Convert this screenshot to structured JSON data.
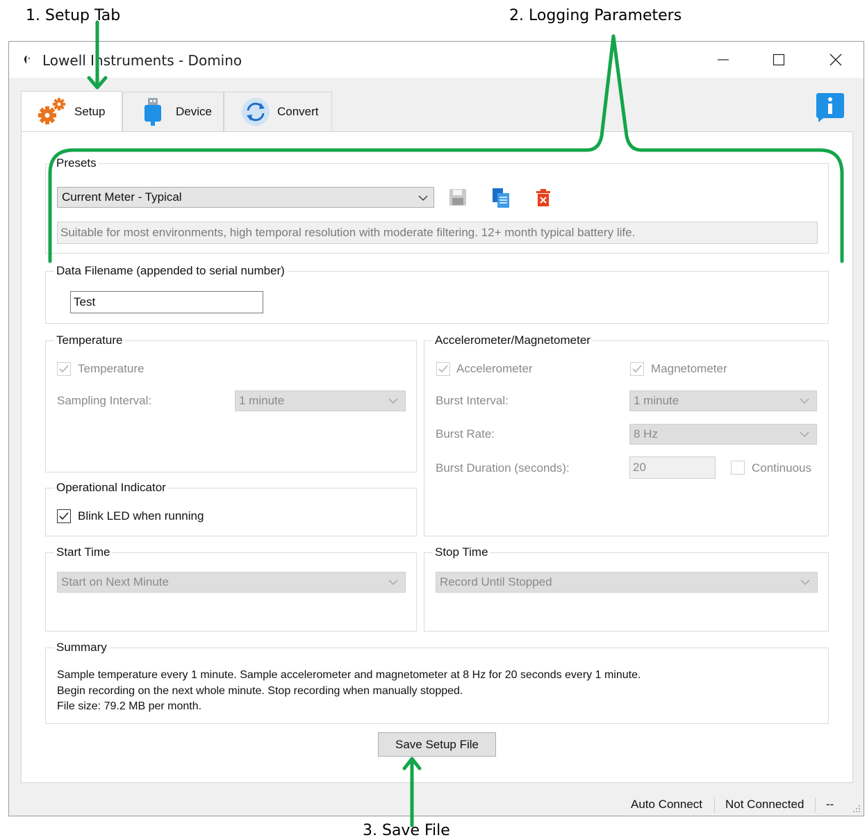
{
  "annotations": {
    "setup_tab": "1. Setup Tab",
    "logging_params": "2. Logging Parameters",
    "save_file": "3. Save File"
  },
  "colors": {
    "annotation_green": "#14a54a",
    "info_blue": "#1e90e6",
    "gear_orange": "#e8731c",
    "delete_red": "#e8401c"
  },
  "window": {
    "title": "Lowell Instruments - Domino",
    "minimize_icon": "minimize-icon",
    "maximize_icon": "maximize-icon",
    "close_icon": "close-icon"
  },
  "tabs": [
    {
      "label": "Setup",
      "icon": "gears-icon",
      "active": true
    },
    {
      "label": "Device",
      "icon": "usb-device-icon",
      "active": false
    },
    {
      "label": "Convert",
      "icon": "convert-refresh-icon",
      "active": false
    }
  ],
  "presets": {
    "group_label": "Presets",
    "selected": "Current Meter - Typical",
    "description": "Suitable for most environments, high temporal resolution with moderate filtering. 12+ month typical battery life."
  },
  "filename": {
    "group_label": "Data Filename (appended to serial number)",
    "value": "Test"
  },
  "temperature": {
    "group_label": "Temperature",
    "checkbox_label": "Temperature",
    "checked": true,
    "interval_label": "Sampling Interval:",
    "interval_value": "1 minute"
  },
  "accel_mag": {
    "group_label": "Accelerometer/Magnetometer",
    "accelerometer_label": "Accelerometer",
    "accelerometer_checked": true,
    "magnetometer_label": "Magnetometer",
    "magnetometer_checked": true,
    "burst_interval_label": "Burst Interval:",
    "burst_interval_value": "1 minute",
    "burst_rate_label": "Burst Rate:",
    "burst_rate_value": "8 Hz",
    "burst_duration_label": "Burst Duration (seconds):",
    "burst_duration_value": "20",
    "continuous_label": "Continuous",
    "continuous_checked": false
  },
  "operational": {
    "group_label": "Operational Indicator",
    "blink_label": "Blink LED when running",
    "blink_checked": true
  },
  "start_time": {
    "group_label": "Start Time",
    "value": "Start on Next Minute"
  },
  "stop_time": {
    "group_label": "Stop Time",
    "value": "Record Until Stopped"
  },
  "summary": {
    "group_label": "Summary",
    "line1": "Sample temperature every 1 minute. Sample accelerometer and magnetometer at 8 Hz for 20 seconds every 1 minute.",
    "line2": "Begin recording on the next whole minute. Stop recording when manually stopped.",
    "line3": "File size: 79.2 MB per month."
  },
  "save_button": "Save Setup File",
  "status": {
    "auto_connect": "Auto Connect",
    "connection": "Not Connected",
    "extra": "--"
  }
}
